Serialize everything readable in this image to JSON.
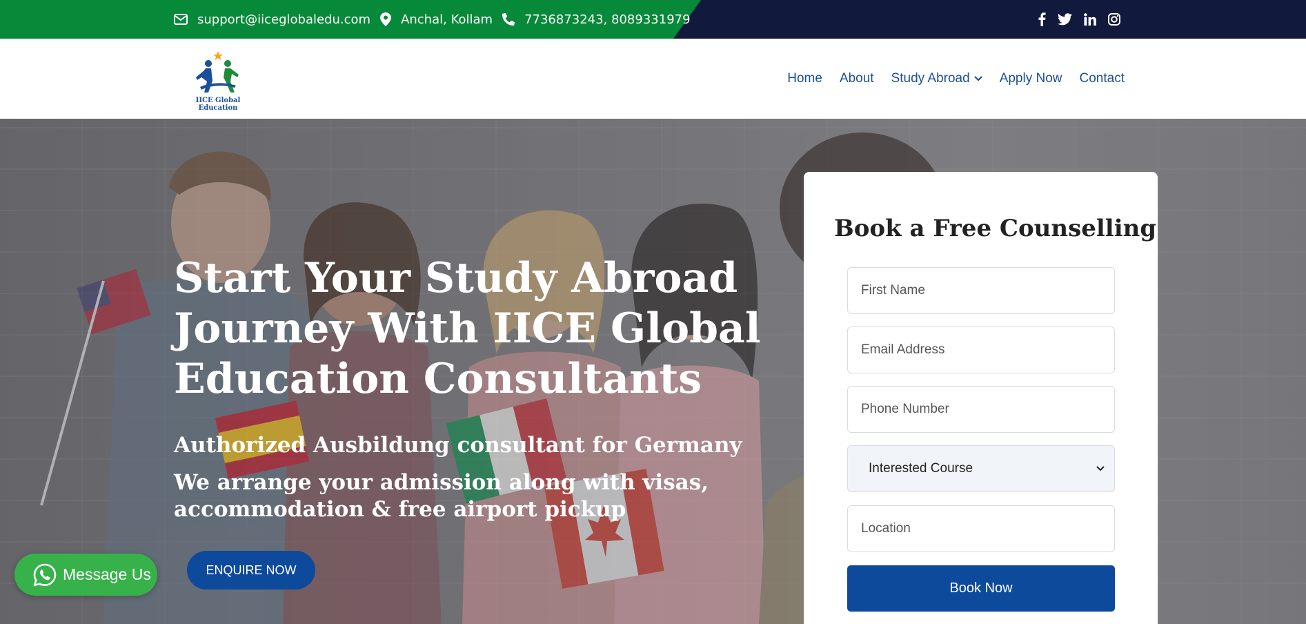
{
  "topbar": {
    "email": "support@iiceglobaledu.com",
    "location": "Anchal, Kollam",
    "phone": "7736873243, 8089331979",
    "social_icons": [
      "facebook-icon",
      "twitter-icon",
      "linkedin-icon",
      "instagram-icon"
    ]
  },
  "brand": {
    "logo_text": "IICE Global Education"
  },
  "nav": {
    "items": [
      {
        "label": "Home"
      },
      {
        "label": "About"
      },
      {
        "label": "Study Abroad"
      },
      {
        "label": "Apply Now"
      },
      {
        "label": "Contact"
      }
    ]
  },
  "hero": {
    "title": "Start Your Study Abroad Journey With IICE Global Education Consultants",
    "subtitle1": "Authorized Ausbildung consultant for Germany",
    "subtitle2": "We arrange your admission along with visas, accommodation & free airport pickup",
    "cta_label": "ENQUIRE NOW"
  },
  "form": {
    "title": "Book a Free Counselling",
    "first_name_placeholder": "First Name",
    "email_placeholder": "Email Address",
    "phone_placeholder": "Phone Number",
    "course_selected": "Interested Course",
    "location_placeholder": "Location",
    "submit_label": "Book Now"
  },
  "whatsapp": {
    "label": "Message Us"
  },
  "colors": {
    "green": "#07893a",
    "navy": "#111a3d",
    "primary": "#0d4a9b",
    "nav_link": "#1b4f9c",
    "whatsapp": "#37b24a"
  }
}
